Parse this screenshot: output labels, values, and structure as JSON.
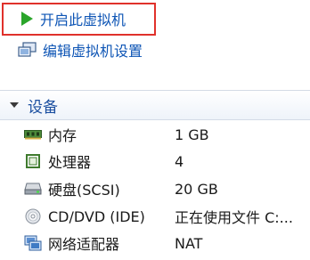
{
  "actions": {
    "start_vm": "开启此虚拟机",
    "edit_settings": "编辑虚拟机设置"
  },
  "devices_section": {
    "title": "设备",
    "items": [
      {
        "icon": "memory-icon",
        "name": "内存",
        "value": "1 GB"
      },
      {
        "icon": "processor-icon",
        "name": "处理器",
        "value": "4"
      },
      {
        "icon": "hard-disk-icon",
        "name": "硬盘(SCSI)",
        "value": "20 GB"
      },
      {
        "icon": "cd-dvd-icon",
        "name": "CD/DVD (IDE)",
        "value": "正在使用文件 C:..."
      },
      {
        "icon": "network-adapter-icon",
        "name": "网络适配器",
        "value": "NAT"
      }
    ]
  },
  "colors": {
    "link": "#0e55b5",
    "highlight_border": "#e0312b",
    "play_green": "#2aa52a"
  }
}
